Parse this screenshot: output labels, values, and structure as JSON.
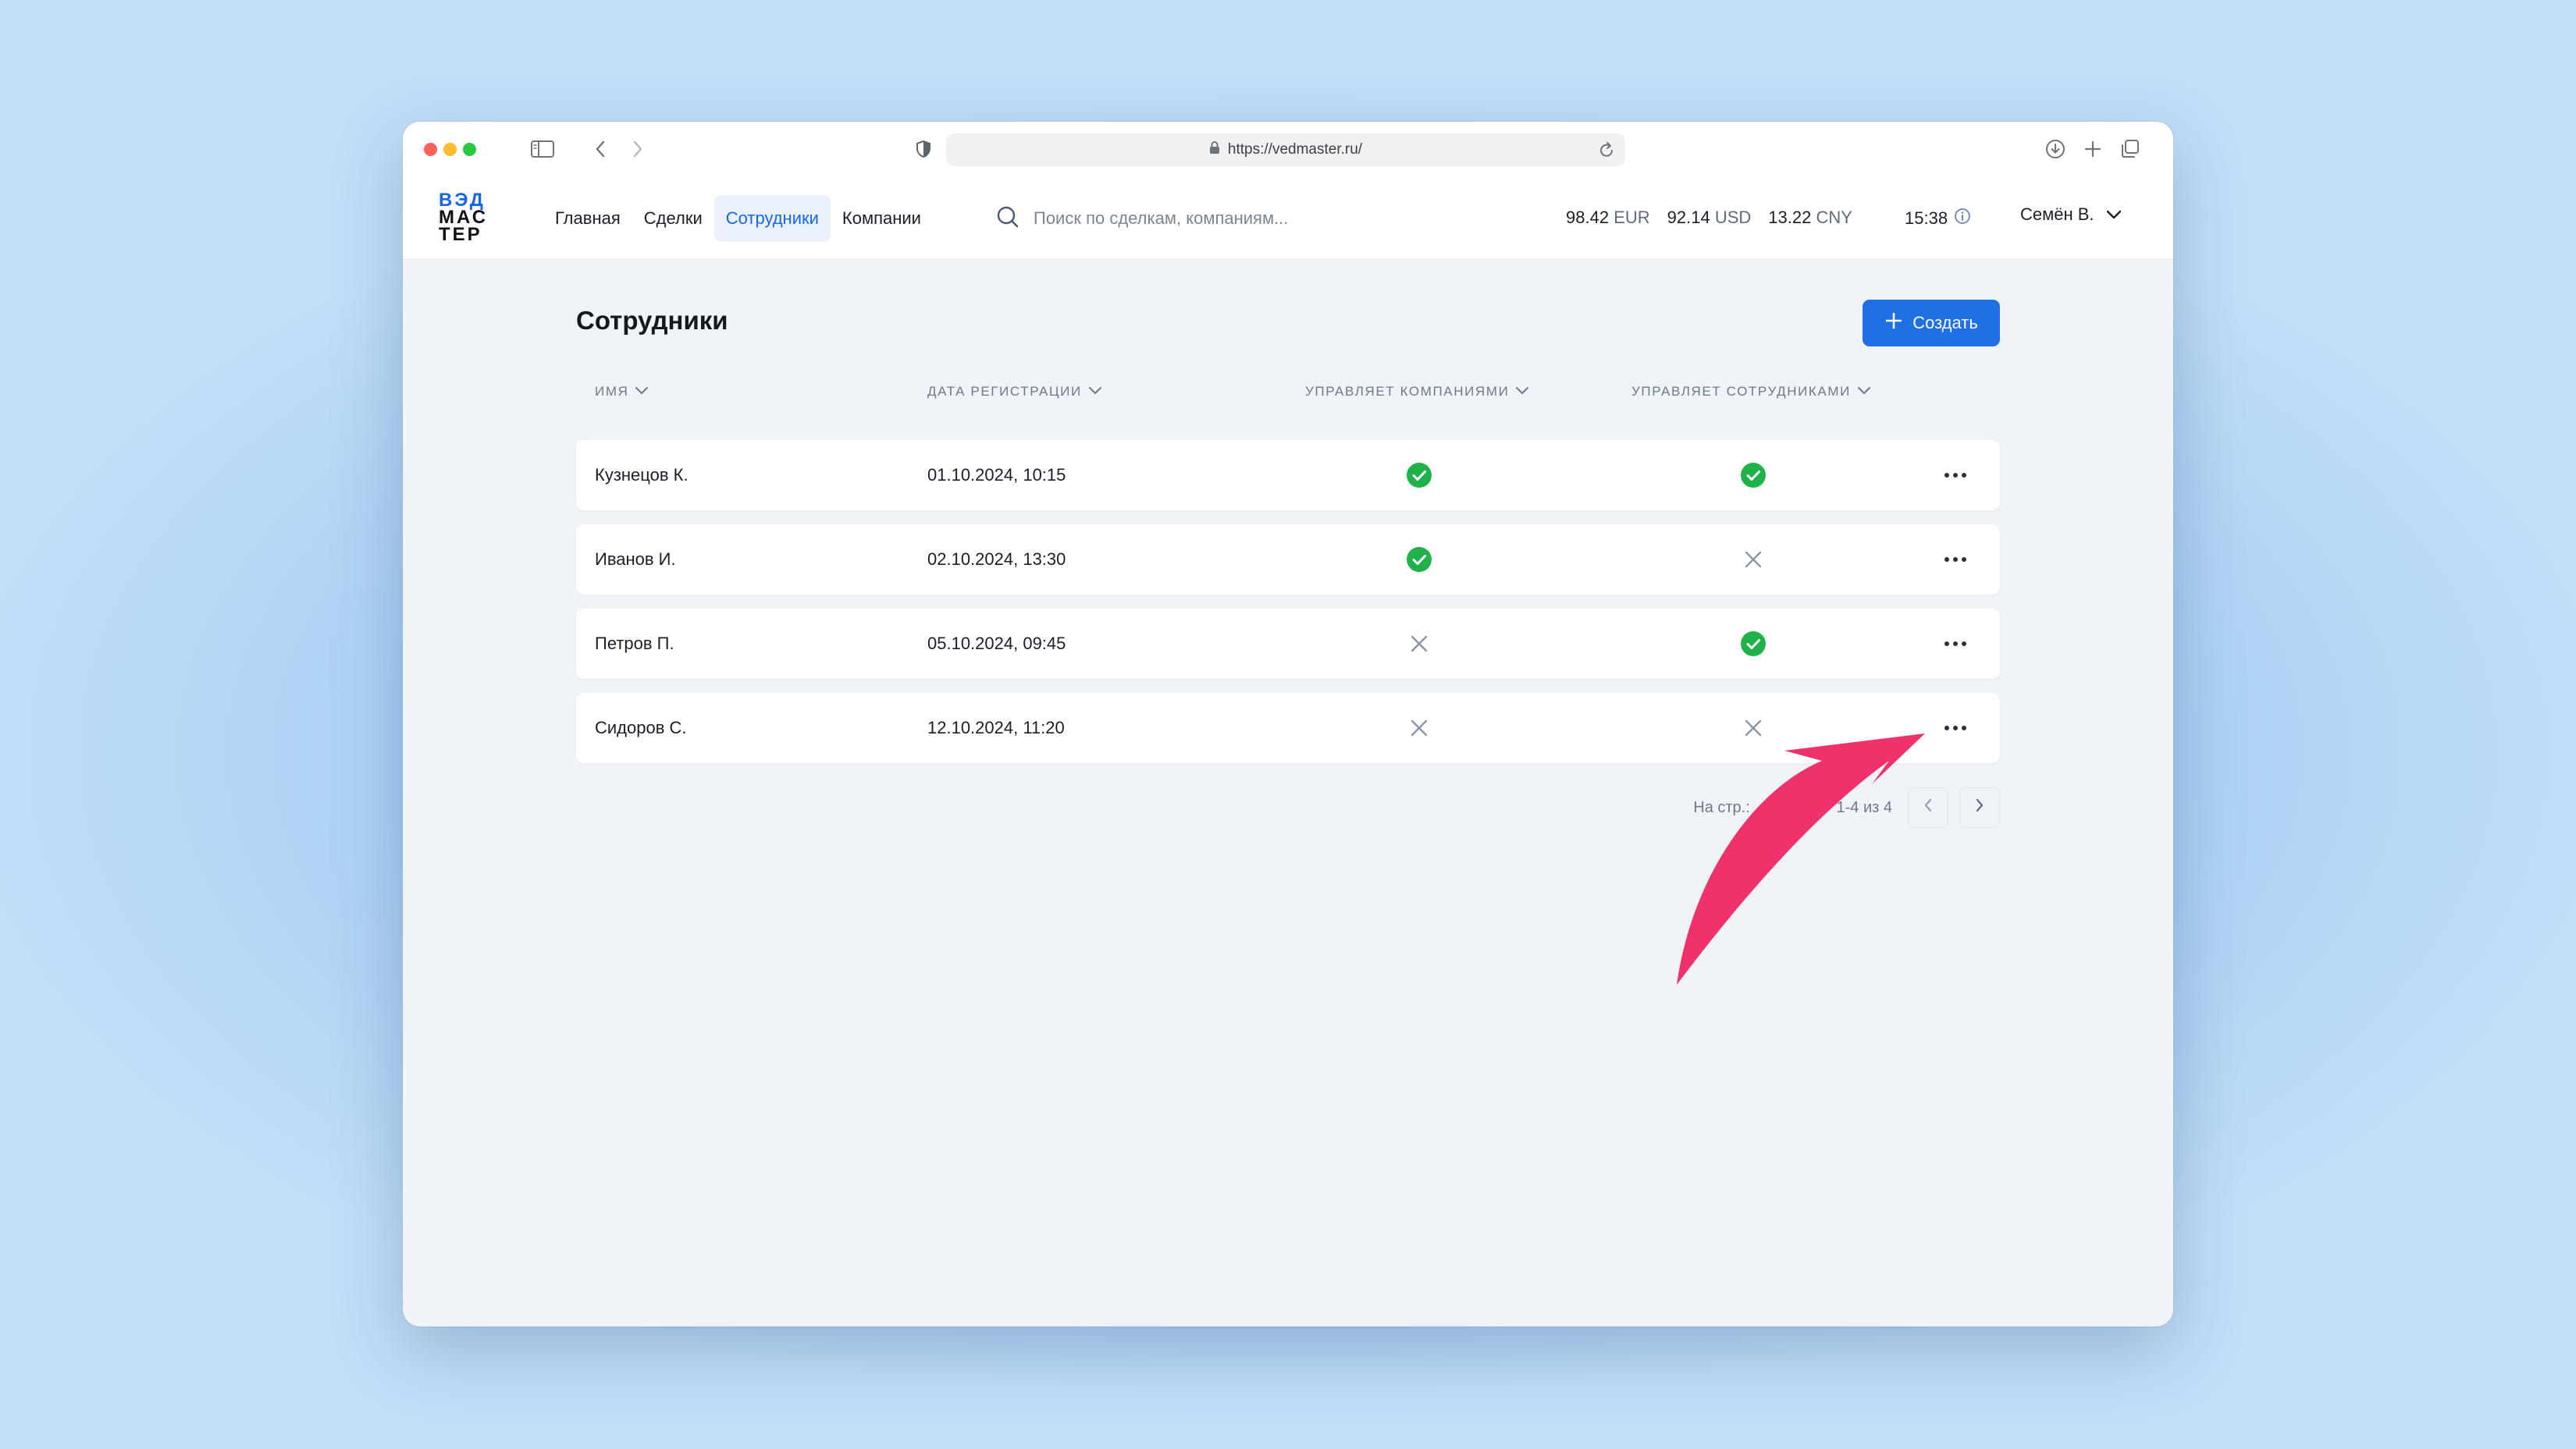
{
  "browser": {
    "url": "https://vedmaster.ru/"
  },
  "logo": {
    "line1": "ВЭД",
    "line2": "МАС",
    "line3": "ТЕР"
  },
  "nav": {
    "items": [
      {
        "label": "Главная",
        "active": false
      },
      {
        "label": "Сделки",
        "active": false
      },
      {
        "label": "Сотрудники",
        "active": true
      },
      {
        "label": "Компании",
        "active": false
      }
    ]
  },
  "search": {
    "placeholder": "Поиск по сделкам, компаниям..."
  },
  "rates": [
    {
      "value": "98.42",
      "currency": "EUR"
    },
    {
      "value": "92.14",
      "currency": "USD"
    },
    {
      "value": "13.22",
      "currency": "CNY"
    }
  ],
  "clock": {
    "time": "15:38"
  },
  "user": {
    "name": "Семён В."
  },
  "page": {
    "title": "Сотрудники",
    "create_label": "Создать"
  },
  "table": {
    "columns": [
      "Имя",
      "Дата регистрации",
      "Управляет компаниями",
      "Управляет сотрудниками"
    ],
    "rows": [
      {
        "name": "Кузнецов К.",
        "date": "01.10.2024, 10:15",
        "manages_companies": true,
        "manages_employees": true
      },
      {
        "name": "Иванов И.",
        "date": "02.10.2024, 13:30",
        "manages_companies": true,
        "manages_employees": false
      },
      {
        "name": "Петров П.",
        "date": "05.10.2024, 09:45",
        "manages_companies": false,
        "manages_employees": true
      },
      {
        "name": "Сидоров С.",
        "date": "12.10.2024, 11:20",
        "manages_companies": false,
        "manages_employees": false
      }
    ]
  },
  "pagination": {
    "per_page_label": "На стр.:",
    "per_page": "100",
    "range": "1-4 из 4"
  },
  "colors": {
    "accent": "#1f6fe5",
    "check": "#1fb24a",
    "cross": "#8a97a8",
    "annotation_arrow": "#f0326b"
  },
  "icons": {
    "check": "check-circle-icon",
    "cross": "cross-icon",
    "more": "more-dots-icon"
  }
}
